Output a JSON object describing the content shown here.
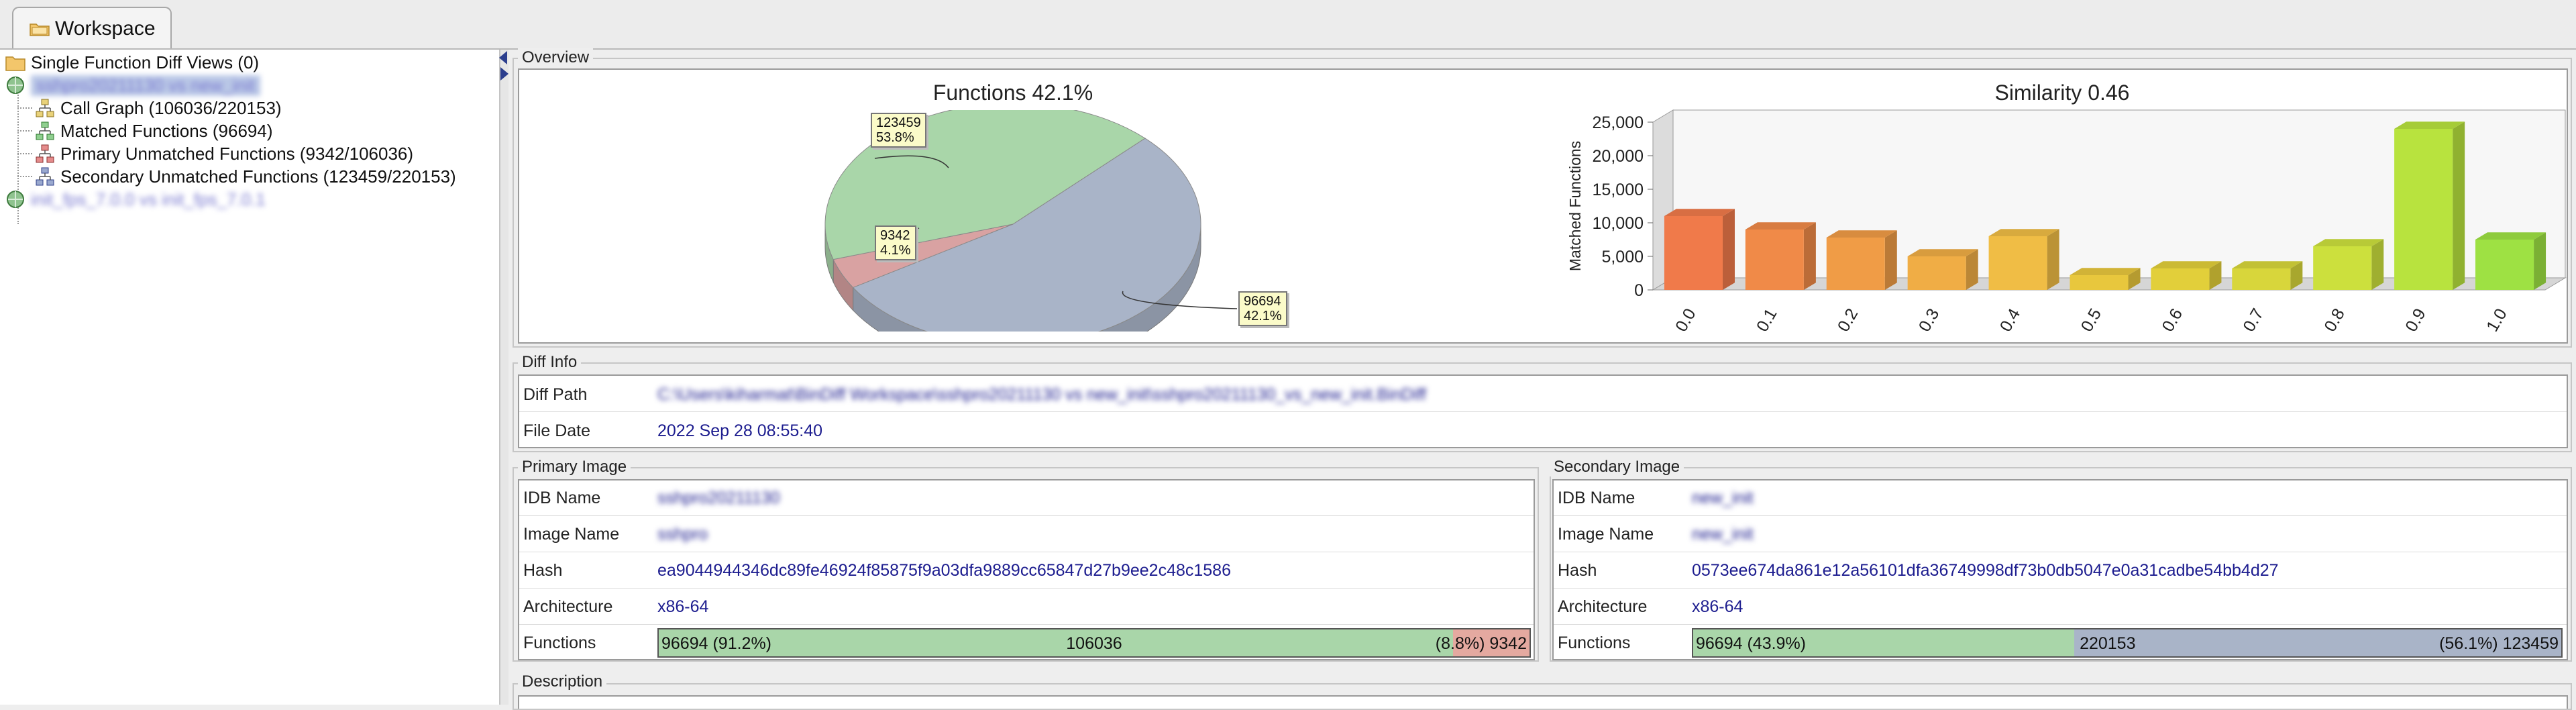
{
  "tab": {
    "label": "Workspace"
  },
  "tree": {
    "items": [
      {
        "label": "Single Function Diff Views (0)"
      },
      {
        "label": "sshpro20211130 vs new_init"
      },
      {
        "label": "Call Graph (106036/220153)"
      },
      {
        "label": "Matched Functions (96694)"
      },
      {
        "label": "Primary Unmatched Functions (9342/106036)"
      },
      {
        "label": "Secondary Unmatched Functions (123459/220153)"
      },
      {
        "label": "init_fps_7.0.0 vs init_fps_7.0.1"
      }
    ]
  },
  "overview": {
    "title": "Overview",
    "pie": {
      "title": "Functions 42.1%",
      "callouts": [
        {
          "label": "123459\n53.8%"
        },
        {
          "label": "9342\n4.1%"
        },
        {
          "label": "96694\n42.1%"
        }
      ]
    },
    "bar": {
      "title": "Similarity 0.46"
    }
  },
  "chart_data": [
    {
      "type": "pie",
      "title": "Functions 42.1%",
      "slices": [
        {
          "value": 123459,
          "percent": 53.8,
          "color": "#a9b4c8"
        },
        {
          "value": 9342,
          "percent": 4.1,
          "color": "#d9a2a2"
        },
        {
          "value": 96694,
          "percent": 42.1,
          "color": "#a9d6a9"
        }
      ]
    },
    {
      "type": "bar",
      "title": "Similarity 0.46",
      "ylabel": "Matched Functions",
      "categories": [
        "0.0",
        "0.1",
        "0.2",
        "0.3",
        "0.4",
        "0.5",
        "0.6",
        "0.7",
        "0.8",
        "0.9",
        "1.0"
      ],
      "values": [
        11000,
        9000,
        7800,
        5000,
        8000,
        2200,
        3200,
        3200,
        6500,
        24000,
        7500
      ],
      "colors": [
        "#f07a4a",
        "#f08a48",
        "#f09c46",
        "#f0ad45",
        "#f0bd45",
        "#e8c73d",
        "#e2cf3a",
        "#d8d63b",
        "#cce03d",
        "#b8e33e",
        "#9ee143"
      ],
      "ylim": [
        0,
        25000
      ],
      "yticks": [
        "0",
        "5,000",
        "10,000",
        "15,000",
        "20,000",
        "25,000"
      ]
    }
  ],
  "diff_info": {
    "title": "Diff Info",
    "diff_path_label": "Diff Path",
    "diff_path_value": "C:\\Users\\kiharmat\\BinDiff Workspace\\sshpro20211130 vs new_init\\sshpro20211130_vs_new_init.BinDiff",
    "file_date_label": "File Date",
    "file_date_value": "2022 Sep 28 08:55:40"
  },
  "primary": {
    "title": "Primary Image",
    "rows": [
      {
        "label": "IDB Name",
        "value": "sshpro20211130"
      },
      {
        "label": "Image Name",
        "value": "sshpro"
      },
      {
        "label": "Hash",
        "value": "ea9044944346dc89fe46924f85875f9a03dfa9889cc65847d27b9ee2c48c1586"
      },
      {
        "label": "Architecture",
        "value": "x86-64"
      },
      {
        "label": "Functions",
        "value": ""
      }
    ],
    "functions": {
      "matched": "96694 (91.2%)",
      "total": "106036",
      "unmatched": "(8.8%) 9342",
      "matched_frac": 0.912
    }
  },
  "secondary": {
    "title": "Secondary Image",
    "rows": [
      {
        "label": "IDB Name",
        "value": "new_init"
      },
      {
        "label": "Image Name",
        "value": "new_init"
      },
      {
        "label": "Hash",
        "value": "0573ee674da861e12a56101dfa36749998df73b0db5047e0a31cadbe54bb4d27"
      },
      {
        "label": "Architecture",
        "value": "x86-64"
      },
      {
        "label": "Functions",
        "value": ""
      }
    ],
    "functions": {
      "matched": "96694 (43.9%)",
      "total": "220153",
      "unmatched": "(56.1%) 123459",
      "matched_frac": 0.439
    }
  },
  "description": {
    "title": "Description"
  },
  "colors": {
    "matched": "#a9d6a9",
    "primary_unmatched": "#d9a2a2",
    "secondary_unmatched": "#a9b4c8",
    "value_text": "#1d1d8f"
  }
}
